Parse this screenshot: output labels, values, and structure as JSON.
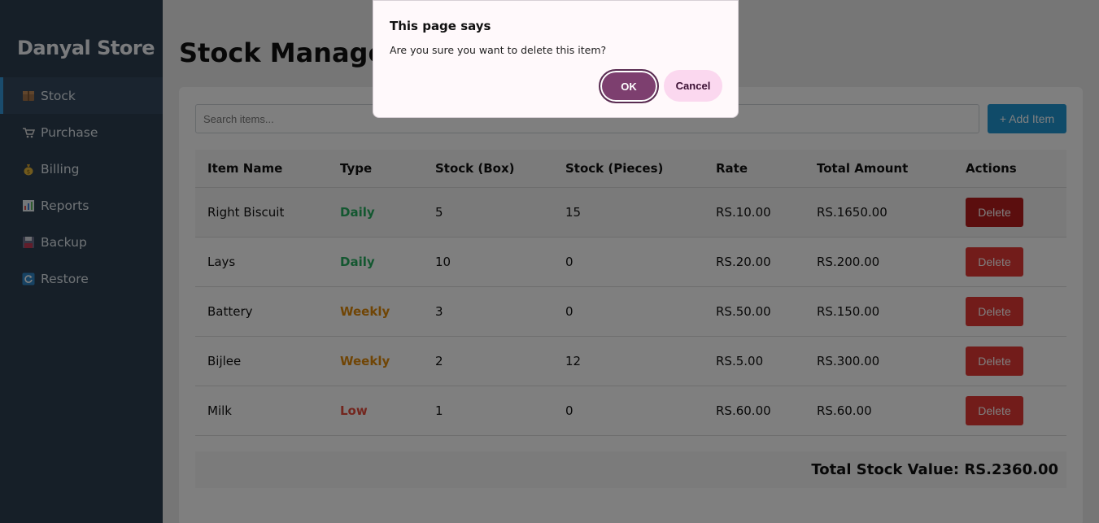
{
  "sidebar": {
    "brand": "Danyal Store",
    "items": [
      {
        "icon": "package-icon",
        "label": "Stock"
      },
      {
        "icon": "cart-icon",
        "label": "Purchase"
      },
      {
        "icon": "money-bag-icon",
        "label": "Billing"
      },
      {
        "icon": "chart-icon",
        "label": "Reports"
      },
      {
        "icon": "floppy-disk-icon",
        "label": "Backup"
      },
      {
        "icon": "refresh-icon",
        "label": "Restore"
      }
    ]
  },
  "main": {
    "title": "Stock Management",
    "search_placeholder": "Search items...",
    "add_label": "+ Add Item",
    "columns": [
      "Item Name",
      "Type",
      "Stock (Box)",
      "Stock (Pieces)",
      "Rate",
      "Total Amount",
      "Actions"
    ],
    "rows": [
      {
        "name": "Right Biscuit",
        "type": "Daily",
        "box": "5",
        "pieces": "15",
        "rate": "RS.10.00",
        "total": "RS.1650.00",
        "action": "Delete"
      },
      {
        "name": "Lays",
        "type": "Daily",
        "box": "10",
        "pieces": "0",
        "rate": "RS.20.00",
        "total": "RS.200.00",
        "action": "Delete"
      },
      {
        "name": "Battery",
        "type": "Weekly",
        "box": "3",
        "pieces": "0",
        "rate": "RS.50.00",
        "total": "RS.150.00",
        "action": "Delete"
      },
      {
        "name": "Bijlee",
        "type": "Weekly",
        "box": "2",
        "pieces": "12",
        "rate": "RS.5.00",
        "total": "RS.300.00",
        "action": "Delete"
      },
      {
        "name": "Milk",
        "type": "Low",
        "box": "1",
        "pieces": "0",
        "rate": "RS.60.00",
        "total": "RS.60.00",
        "action": "Delete"
      }
    ],
    "total_label": "Total Stock Value: RS.2360.00"
  },
  "dialog": {
    "title": "This page says",
    "message": "Are you sure you want to delete this item?",
    "ok": "OK",
    "cancel": "Cancel"
  },
  "colors": {
    "sidebar_bg": "#2c3e50",
    "primary": "#2196d3",
    "danger": "#e53935",
    "daily": "#27ae60",
    "weekly": "#e08a0b",
    "low": "#e74c3c",
    "dialog_ok": "#7d3f6f",
    "dialog_cancel": "#fbd8ef"
  }
}
